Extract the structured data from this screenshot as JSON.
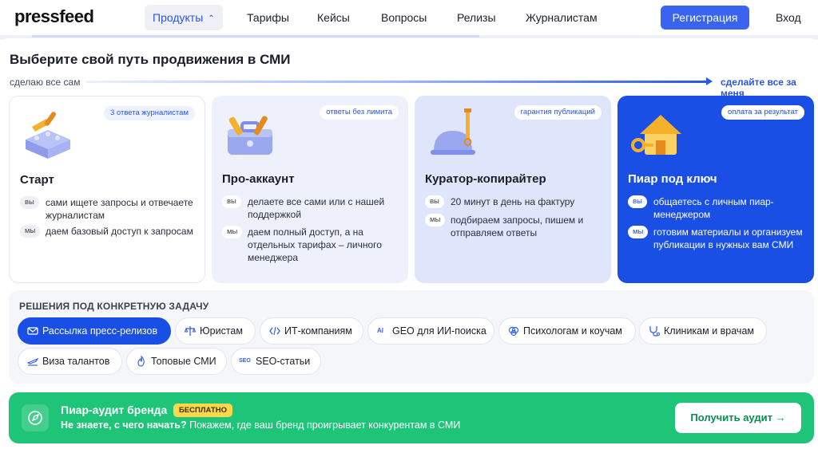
{
  "nav": {
    "logo": "pressfeed",
    "items": [
      "Продукты",
      "Тарифы",
      "Кейсы",
      "Вопросы",
      "Релизы",
      "Журналистам"
    ],
    "register": "Регистрация",
    "login": "Вход"
  },
  "panel": {
    "title": "Выберите свой путь продвижения в СМИ",
    "path_left": "сделаю все сам",
    "path_right": "сделайте все за меня"
  },
  "cards": [
    {
      "badge": "3 ответа журналистам",
      "title": "Старт",
      "rows": [
        {
          "who": "вы",
          "text": "сами ищете запросы и отвечаете журналистам"
        },
        {
          "who": "мы",
          "text": "даем базовый доступ к запросам"
        }
      ]
    },
    {
      "badge": "ответы без лимита",
      "title": "Про-аккаунт",
      "rows": [
        {
          "who": "вы",
          "text": "делаете все сами или с нашей поддержкой"
        },
        {
          "who": "мы",
          "text": "даем полный доступ, а на отдельных тарифах – личного менеджера"
        }
      ]
    },
    {
      "badge": "гарантия публикаций",
      "title": "Куратор-копирайтер",
      "rows": [
        {
          "who": "вы",
          "text": "20 минут в день на фактуру"
        },
        {
          "who": "мы",
          "text": "подбираем запросы, пишем и отправляем ответы"
        }
      ]
    },
    {
      "badge": "оплата за результат",
      "title": "Пиар под ключ",
      "rows": [
        {
          "who": "вы",
          "text": "общаетесь с личным пиар-менеджером"
        },
        {
          "who": "мы",
          "text": "готовим материалы и организуем публикации в нужных вам СМИ"
        }
      ]
    }
  ],
  "solutions": {
    "title": "РЕШЕНИЯ ПОД КОНКРЕТНУЮ ЗАДАЧУ",
    "chips": [
      "Рассылка пресс-релизов",
      "Юристам",
      "ИТ-компаниям",
      "GEO для ИИ-поиска",
      "Психологам и коучам",
      "Клиникам и врачам",
      "Виза талантов",
      "Топовые СМИ",
      "SEO-статьи"
    ],
    "icon_text_ai": "AI",
    "icon_text_seo": "SEO"
  },
  "audit": {
    "title": "Пиар-аудит бренда",
    "badge": "БЕСПЛАТНО",
    "question": "Не знаете, с чего начать?",
    "text": " Покажем, где ваш бренд проигрывает конкурентам в СМИ",
    "button": "Получить аудит"
  },
  "colors": {
    "accent": "#3a63f0",
    "card_blue": "#1a4fe6",
    "audit_green": "#1ec477",
    "badge_yellow": "#ffd84a"
  }
}
